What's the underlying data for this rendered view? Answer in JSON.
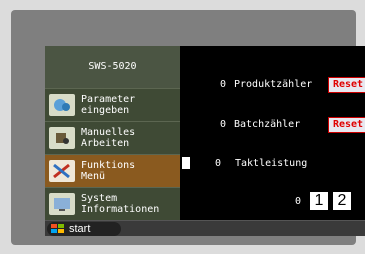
{
  "sidebar": {
    "title": "SWS-5020",
    "items": [
      {
        "label": "Parameter\neingeben",
        "icon": "parameter-icon"
      },
      {
        "label": "Manuelles\nArbeiten",
        "icon": "manual-work-icon"
      },
      {
        "label": "Funktions\nMenü",
        "icon": "functions-icon"
      },
      {
        "label": "System\nInformationen",
        "icon": "system-info-icon"
      }
    ]
  },
  "main": {
    "produktzaehler": {
      "value": "0",
      "label": "Produktzähler",
      "reset": "Reset"
    },
    "batchzaehler": {
      "value": "0",
      "label": "Batchzähler",
      "reset": "Reset"
    },
    "taktleistung": {
      "value": "0",
      "label": "Taktleistung"
    },
    "counter": {
      "value": "0",
      "btn1": "1",
      "btn2": "2"
    }
  },
  "taskbar": {
    "start_label": "start"
  },
  "colors": {
    "accent": "#8a5a1f",
    "reset_text": "#e00000"
  }
}
